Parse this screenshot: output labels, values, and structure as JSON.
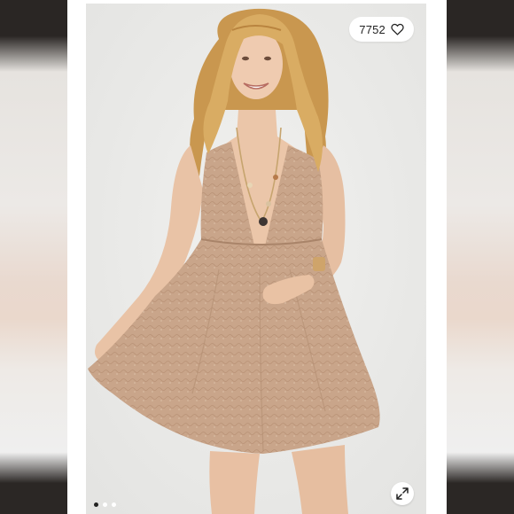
{
  "listing": {
    "like_count": "7752"
  },
  "gallery": {
    "image_count": 3,
    "active_index": 0
  },
  "icons": {
    "like": "heart-icon",
    "expand": "expand-arrows-icon"
  },
  "colors": {
    "dress": "#c9a58a",
    "background": "#ececea",
    "hair": "#d6a95f"
  }
}
